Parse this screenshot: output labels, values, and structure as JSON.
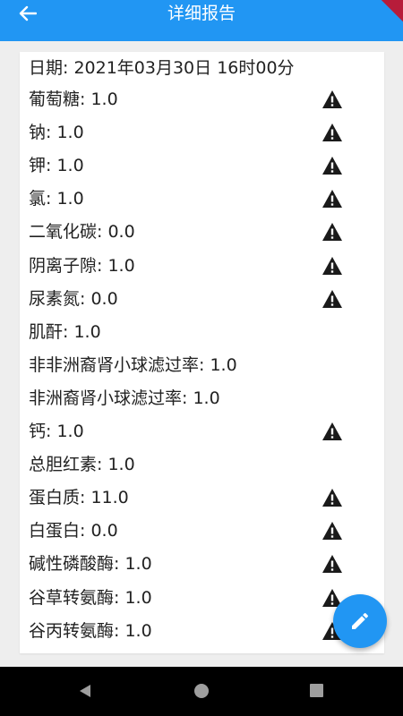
{
  "app": {
    "title": "详细报告",
    "accent_color": "#2196f3"
  },
  "report": {
    "date_line": "日期: 2021年03月30日 16时00分",
    "items": [
      {
        "text": "葡萄糖: 1.0",
        "warning": true
      },
      {
        "text": "钠: 1.0",
        "warning": true
      },
      {
        "text": "钾: 1.0",
        "warning": true
      },
      {
        "text": "氯: 1.0",
        "warning": true
      },
      {
        "text": "二氧化碳: 0.0",
        "warning": true
      },
      {
        "text": "阴离子隙: 1.0",
        "warning": true
      },
      {
        "text": "尿素氮: 0.0",
        "warning": true
      },
      {
        "text": "肌酐: 1.0",
        "warning": false
      },
      {
        "text": "非非洲裔肾小球滤过率: 1.0",
        "warning": false
      },
      {
        "text": "非洲裔肾小球滤过率: 1.0",
        "warning": false
      },
      {
        "text": "钙: 1.0",
        "warning": true
      },
      {
        "text": "总胆红素: 1.0",
        "warning": false
      },
      {
        "text": "蛋白质: 11.0",
        "warning": true
      },
      {
        "text": "白蛋白: 0.0",
        "warning": true
      },
      {
        "text": "碱性磷酸酶: 1.0",
        "warning": true
      },
      {
        "text": "谷草转氨酶: 1.0",
        "warning": true
      },
      {
        "text": "谷丙转氨酶: 1.0",
        "warning": true
      }
    ]
  },
  "icons": {
    "back": "arrow-back-icon",
    "warning": "warning-icon",
    "edit": "pencil-icon"
  }
}
